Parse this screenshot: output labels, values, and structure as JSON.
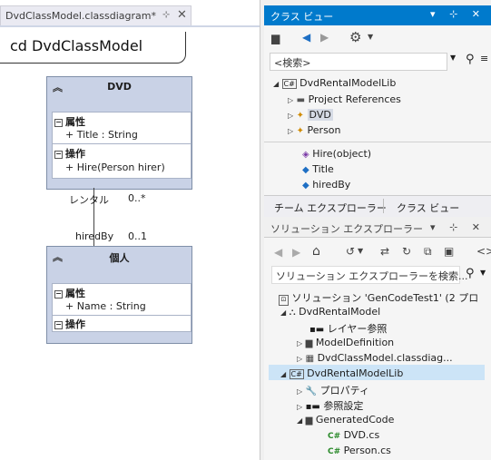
{
  "doc_tab": {
    "title": "DvdClassModel.classdiagram*",
    "pin": "⊹",
    "close": "✕"
  },
  "diagram": {
    "frame_label": "cd DvdClassModel",
    "dvd_class": {
      "title": "DVD",
      "attr_header": "属性",
      "attr_item": "+ Title : String",
      "op_header": "操作",
      "op_item": "+ Hire(Person hirer)"
    },
    "assoc": {
      "role_top": "レンタル",
      "mult_top": "0..*",
      "role_bottom": "hiredBy",
      "mult_bottom": "0..1"
    },
    "person_class": {
      "title": "個人",
      "attr_header": "属性",
      "attr_item": "+ Name : String",
      "op_header": "操作"
    }
  },
  "class_view": {
    "title": "クラス ビュー",
    "title_icons": "▾ ⊹ ✕",
    "search_placeholder": "<検索>",
    "tree": {
      "lib": "DvdRentalModelLib",
      "project_refs": "Project References",
      "dvd": "DVD",
      "person": "Person"
    },
    "members": [
      "Hire(object)",
      "Title",
      "hiredBy"
    ],
    "bottom_tabs": [
      "チーム エクスプローラー",
      "クラス ビュー"
    ]
  },
  "solution_explorer": {
    "title": "ソリューション エクスプローラー",
    "title_icons": "▾ ⊹ ✕",
    "search_placeholder": "ソリューション エクスプローラーを検索...",
    "solution": "ソリューション 'GenCodeTest1' (2 プロ",
    "project1": "DvdRentalModel",
    "layer_ref": "レイヤー参照",
    "model_def": "ModelDefinition",
    "class_diag": "DvdClassModel.classdiag...",
    "project2": "DvdRentalModelLib",
    "properties": "プロパティ",
    "references": "参照設定",
    "generated": "GeneratedCode",
    "file1": "DVD.cs",
    "file2": "Person.cs"
  },
  "colors": {
    "accent": "#007acc",
    "class_fill": "#c9d2e6",
    "selected": "#cce4f7"
  }
}
